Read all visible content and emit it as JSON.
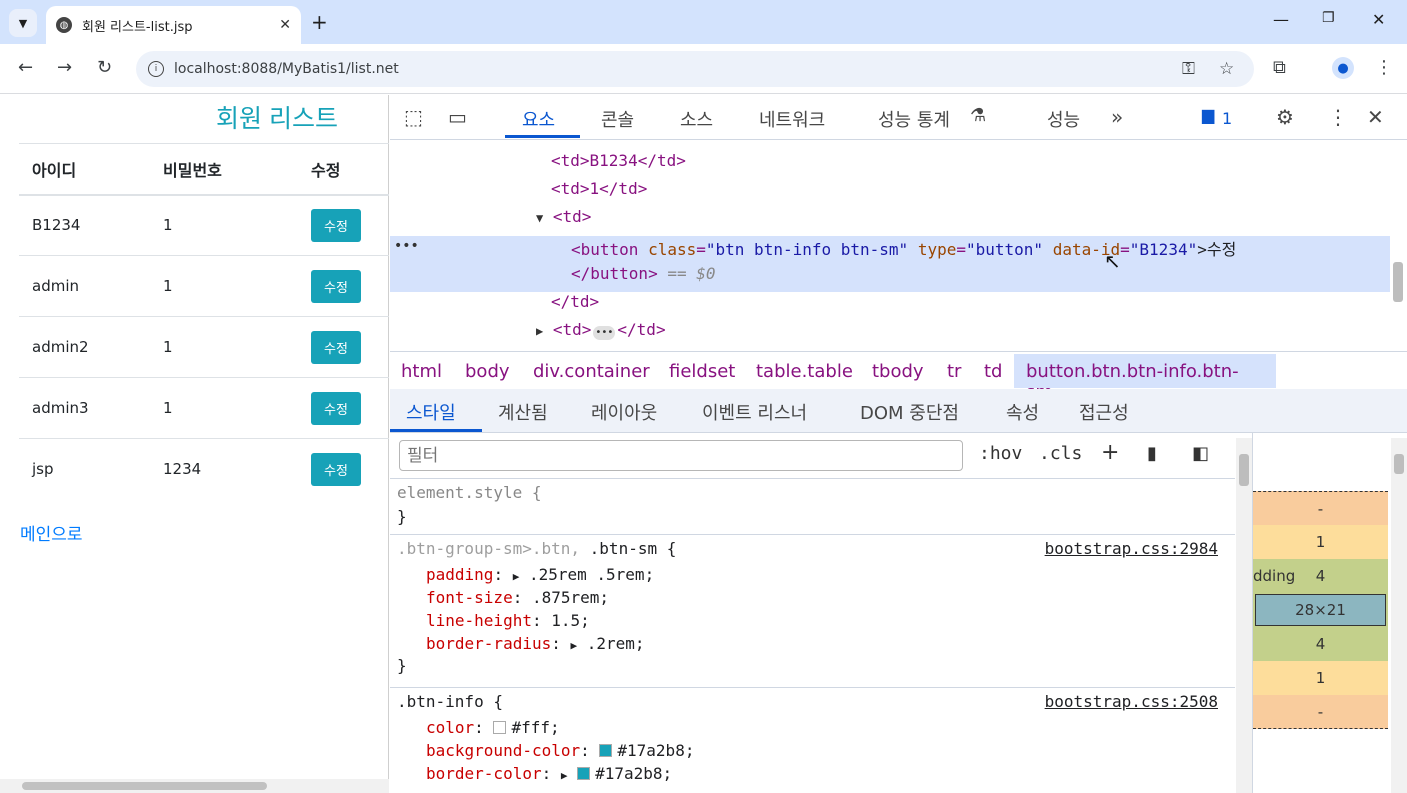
{
  "browser": {
    "tab_title": "회원 리스트-list.jsp",
    "url": "localhost:8088/MyBatis1/list.net"
  },
  "page": {
    "title": "회원 리스트",
    "headers": [
      "아이디",
      "비밀번호",
      "수정"
    ],
    "rows": [
      {
        "id": "B1234",
        "pw": "1",
        "btn": "수정"
      },
      {
        "id": "admin",
        "pw": "1",
        "btn": "수정"
      },
      {
        "id": "admin2",
        "pw": "1",
        "btn": "수정"
      },
      {
        "id": "admin3",
        "pw": "1",
        "btn": "수정"
      },
      {
        "id": "jsp",
        "pw": "1234",
        "btn": "수정"
      }
    ],
    "main_link": "메인으로"
  },
  "devtools": {
    "tabs": [
      "요소",
      "콘솔",
      "소스",
      "네트워크",
      "성능 통계",
      "성능"
    ],
    "issue_count": "1",
    "elements": {
      "line1": "<td>B1234</td>",
      "line2": "<td>1</td>",
      "line3": "<td>",
      "btn_open": "<button",
      "attr_class": "class",
      "val_class": "\"btn btn-info btn-sm\"",
      "attr_type": "type",
      "val_type": "\"button\"",
      "attr_data": "data-id",
      "val_data": "\"B1234\"",
      "btn_text": ">수정",
      "btn_close": "</button>",
      "eq": "== $0",
      "line_td_close": "</td>",
      "line_td_collapsed_open": "<td>",
      "line_td_collapsed_close": "</td>"
    },
    "breadcrumbs": [
      "html",
      "body",
      "div.container",
      "fieldset",
      "table.table",
      "tbody",
      "tr",
      "td",
      "button.btn.btn-info.btn-sm"
    ],
    "subtabs": [
      "스타일",
      "계산됨",
      "레이아웃",
      "이벤트 리스너",
      "DOM 중단점",
      "속성",
      "접근성"
    ],
    "filter_placeholder": "필터",
    "hov": ":hov",
    "cls": ".cls",
    "styles": {
      "element_style": "element.style {",
      "close": "}",
      "rule1_selector_dim": ".btn-group-sm>.btn,",
      "rule1_selector": " .btn-sm {",
      "rule1_source": "bootstrap.css:2984",
      "rule1_props": [
        {
          "name": "padding",
          "value": ".25rem .5rem;"
        },
        {
          "name": "font-size",
          "value": ".875rem;"
        },
        {
          "name": "line-height",
          "value": "1.5;"
        },
        {
          "name": "border-radius",
          "value": ".2rem;"
        }
      ],
      "rule2_selector": ".btn-info {",
      "rule2_source": "bootstrap.css:2508",
      "rule2_props": [
        {
          "name": "color",
          "value": "#fff;",
          "swatch": "#ffffff"
        },
        {
          "name": "background-color",
          "value": "#17a2b8;",
          "swatch": "#17a2b8"
        },
        {
          "name": "border-color",
          "value": "#17a2b8;",
          "swatch": "#17a2b8"
        }
      ]
    },
    "box_model": {
      "margin": "-",
      "border": "1",
      "padding_label": "dding",
      "padding": "4",
      "content": "28×21",
      "padding_bottom": "4",
      "border_bottom": "1",
      "margin_bottom": "-"
    }
  },
  "colors": {
    "accent": "#17a2b8",
    "link": "#007bff",
    "devtools_active": "#0b57d0"
  }
}
